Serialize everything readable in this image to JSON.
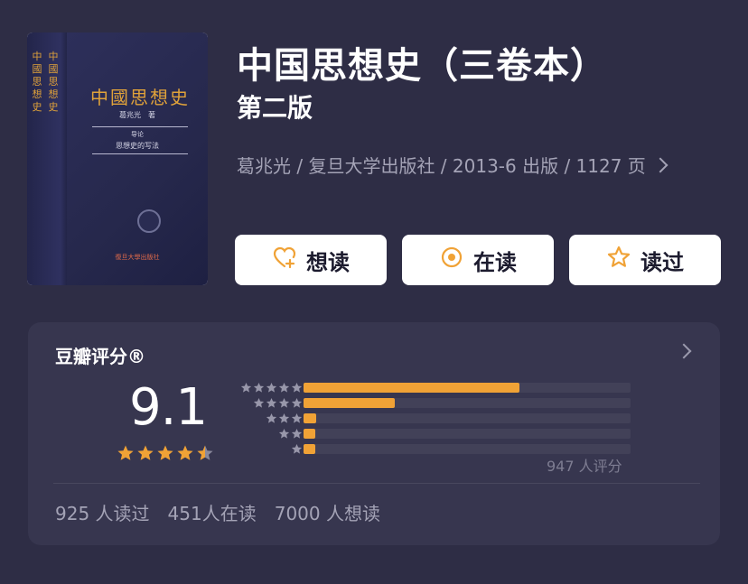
{
  "book": {
    "title": "中国思想史（三卷本）",
    "edition": "第二版",
    "meta": "葛兆光 / 复旦大学出版社 / 2013-6 出版 / 1127 页",
    "cover": {
      "title": "中國思想史",
      "author": "葛兆光　著",
      "volume": "导论",
      "subtitle": "思想史的写法",
      "publisher": "復旦大學出版社",
      "spine_title": "中國思想史",
      "spine_sub": "中國思想史"
    }
  },
  "actions": [
    {
      "label": "想读",
      "icon": "heart-plus-icon"
    },
    {
      "label": "在读",
      "icon": "reading-circle-icon"
    },
    {
      "label": "读过",
      "icon": "star-outline-icon"
    }
  ],
  "rating": {
    "heading": "豆瓣评分®",
    "score": "9.1",
    "score_stars": 4.5,
    "votes": "947 人评分",
    "distribution": [
      {
        "stars": 5,
        "fraction": 0.66
      },
      {
        "stars": 4,
        "fraction": 0.28
      },
      {
        "stars": 3,
        "fraction": 0.04
      },
      {
        "stars": 2,
        "fraction": 0.03
      },
      {
        "stars": 1,
        "fraction": 0.03
      }
    ]
  },
  "stats": {
    "read": "925 人读过",
    "reading": "451人在读",
    "want": "7000 人想读"
  },
  "colors": {
    "background": "#2e2d45",
    "card": "#37364f",
    "accent": "#f0a236",
    "muted": "#a4a3b6"
  }
}
